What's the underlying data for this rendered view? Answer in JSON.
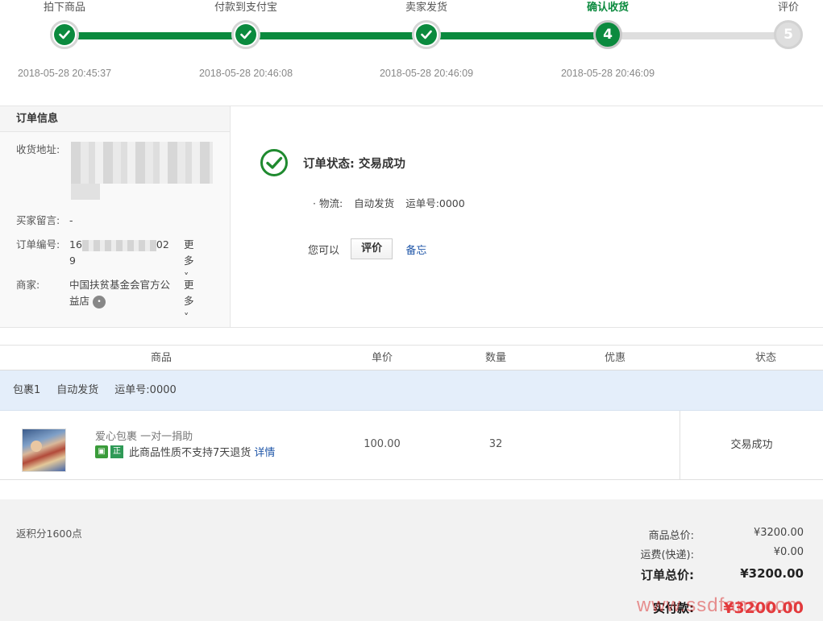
{
  "steps": [
    {
      "label": "拍下商品",
      "time": "2018-05-28 20:45:37",
      "state": "done"
    },
    {
      "label": "付款到支付宝",
      "time": "2018-05-28 20:46:08",
      "state": "done"
    },
    {
      "label": "卖家发货",
      "time": "2018-05-28 20:46:09",
      "state": "done"
    },
    {
      "label": "确认收货",
      "time": "2018-05-28 20:46:09",
      "state": "current",
      "number": "4"
    },
    {
      "label": "评价",
      "time": "",
      "state": "todo",
      "number": "5"
    }
  ],
  "order_info": {
    "title": "订单信息",
    "address_label": "收货地址:",
    "message_label": "买家留言:",
    "message_value": "-",
    "order_no_label": "订单编号:",
    "order_no_prefix": "16",
    "order_no_suffix": "02",
    "order_no_tail": "9",
    "more_label": "更多˅",
    "merchant_label": "商家:",
    "merchant_name": "中国扶贫基金会官方公益店"
  },
  "status_panel": {
    "status_text": "订单状态: 交易成功",
    "logistics_label": "· 物流:",
    "logistics_method": "自动发货",
    "tracking": "运单号:0000",
    "you_can": "您可以",
    "review_button": "评价",
    "memo_link": "备忘"
  },
  "table": {
    "headers": {
      "product": "商品",
      "unit_price": "单价",
      "quantity": "数量",
      "discount": "优惠",
      "status": "状态"
    },
    "package": {
      "name": "包裹1",
      "method": "自动发货",
      "tracking": "运单号:0000"
    },
    "row": {
      "name": "爱心包裹 一对一捐助",
      "tag_b": "正",
      "note": "此商品性质不支持7天退货",
      "detail_link": "详情",
      "unit_price": "100.00",
      "quantity": "32",
      "status": "交易成功"
    }
  },
  "totals": {
    "points": "返积分1600点",
    "goods_total_label": "商品总价:",
    "goods_total": "¥3200.00",
    "shipping_label": "运费(快递):",
    "shipping": "¥0.00",
    "order_total_label": "订单总价:",
    "order_total": "¥3200.00",
    "paid_label": "实付款:",
    "paid": "¥3200.00"
  },
  "watermark": "www.ssdfans.com",
  "colors": {
    "accent_green": "#0b8a3e",
    "link_blue": "#1f56a8",
    "price_red": "#e4393c",
    "package_bg": "#e4eefa"
  }
}
